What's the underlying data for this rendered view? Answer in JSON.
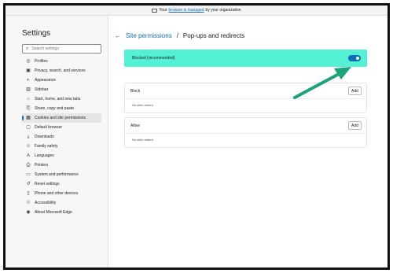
{
  "banner": {
    "prefix": "Your",
    "link": "browser is managed",
    "suffix": "by your organization",
    "icon": "briefcase-icon"
  },
  "sidebar": {
    "title": "Settings",
    "search_placeholder": "Search settings",
    "items": [
      {
        "label": "Profiles",
        "icon": "profile-icon"
      },
      {
        "label": "Privacy, search, and services",
        "icon": "lock-icon"
      },
      {
        "label": "Appearance",
        "icon": "appearance-icon"
      },
      {
        "label": "Sidebar",
        "icon": "sidebar-icon"
      },
      {
        "label": "Start, home, and new tabs",
        "icon": "home-icon"
      },
      {
        "label": "Share, copy and paste",
        "icon": "share-icon"
      },
      {
        "label": "Cookies and site permissions",
        "icon": "cookies-icon",
        "active": true
      },
      {
        "label": "Default browser",
        "icon": "browser-icon"
      },
      {
        "label": "Downloads",
        "icon": "download-icon"
      },
      {
        "label": "Family safety",
        "icon": "family-icon"
      },
      {
        "label": "Languages",
        "icon": "languages-icon"
      },
      {
        "label": "Printers",
        "icon": "printer-icon"
      },
      {
        "label": "System and performance",
        "icon": "system-icon"
      },
      {
        "label": "Reset settings",
        "icon": "reset-icon"
      },
      {
        "label": "Phone and other devices",
        "icon": "phone-icon"
      },
      {
        "label": "Accessibility",
        "icon": "accessibility-icon"
      },
      {
        "label": "About Microsoft Edge",
        "icon": "edge-icon"
      }
    ]
  },
  "main": {
    "breadcrumb_parent": "Site permissions",
    "breadcrumb_sep": "/",
    "breadcrumb_current": "Pop-ups and redirects",
    "toggle": {
      "label": "Blocked (recommended)",
      "on": true
    },
    "block": {
      "title": "Block",
      "add_label": "Add",
      "empty": "No sites added"
    },
    "allow": {
      "title": "Allow",
      "add_label": "Add",
      "empty": "No sites added"
    }
  },
  "colors": {
    "accent": "#0f6cbd",
    "highlight": "#54f0d3",
    "arrow": "#1ba37a"
  }
}
